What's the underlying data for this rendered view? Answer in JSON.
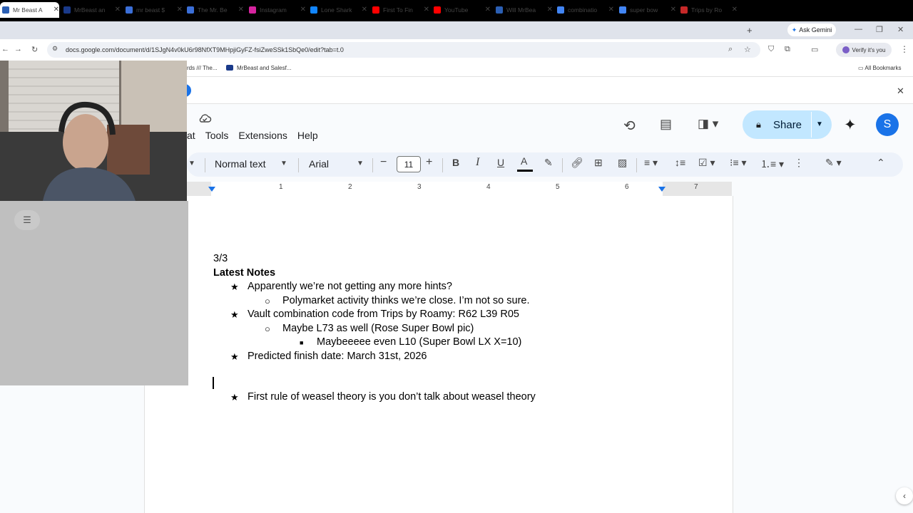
{
  "browser": {
    "tabs": [
      {
        "title": "Mr Beast A",
        "color": "#2b5fb4",
        "active": true
      },
      {
        "title": "MrBeast an",
        "color": "#1a3a8a"
      },
      {
        "title": "mr beast $",
        "color": "#3b6fd8"
      },
      {
        "title": "The Mr. Be",
        "color": "#3b6fd8"
      },
      {
        "title": "Instagram",
        "color": "#d6249f"
      },
      {
        "title": "Lone Shark",
        "color": "#1185fe"
      },
      {
        "title": "First To Fin",
        "color": "#ff0000"
      },
      {
        "title": "YouTube",
        "color": "#ff0000"
      },
      {
        "title": "Will MrBea",
        "color": "#2b5fb4"
      },
      {
        "title": "combinatio",
        "color": "#4285f4"
      },
      {
        "title": "super bow",
        "color": "#4285f4"
      },
      {
        "title": "Trips by Ro",
        "color": "#c62828"
      }
    ],
    "new_tab": "+",
    "ask_gemini": "Ask Gemini",
    "url": "docs.google.com/document/d/1SJgN4v0kU6r98NfXT9MHpjiGyFZ-fsiZweSSk1SbQe0/edit?tab=t.0",
    "verify_label": "Verify it's you",
    "bookmarks": [
      "rds /// The...",
      "MrBeast and Salesf..."
    ],
    "all_bookmarks": "All Bookmarks"
  },
  "docs": {
    "menus": [
      "at",
      "Tools",
      "Extensions",
      "Help"
    ],
    "share_label": "Share",
    "avatar_letter": "S",
    "style_select": "Normal text",
    "font_select": "Arial",
    "font_size": "11",
    "ruler_numbers": [
      "1",
      "2",
      "3",
      "4",
      "5",
      "6",
      "7"
    ]
  },
  "document": {
    "date": "3/3",
    "heading": "Latest Notes",
    "items": [
      {
        "level": 1,
        "bullet": "★",
        "text": "Apparently we’re not getting any more hints?"
      },
      {
        "level": 2,
        "bullet": "○",
        "text": "Polymarket activity thinks we’re close. I’m not so sure."
      },
      {
        "level": 1,
        "bullet": "★",
        "text": "Vault combination code from Trips by Roamy: R62 L39 R05"
      },
      {
        "level": 2,
        "bullet": "○",
        "text": "Maybe L73 as well (Rose Super Bowl pic)"
      },
      {
        "level": 3,
        "bullet": "■",
        "text": "Maybeeeee even L10 (Super Bowl LX  X=10)"
      },
      {
        "level": 1,
        "bullet": "★",
        "text": "Predicted finish date: March 31st, 2026"
      }
    ],
    "last_item": {
      "bullet": "★",
      "text": "First rule of weasel theory is you don’t talk about weasel theory"
    }
  }
}
